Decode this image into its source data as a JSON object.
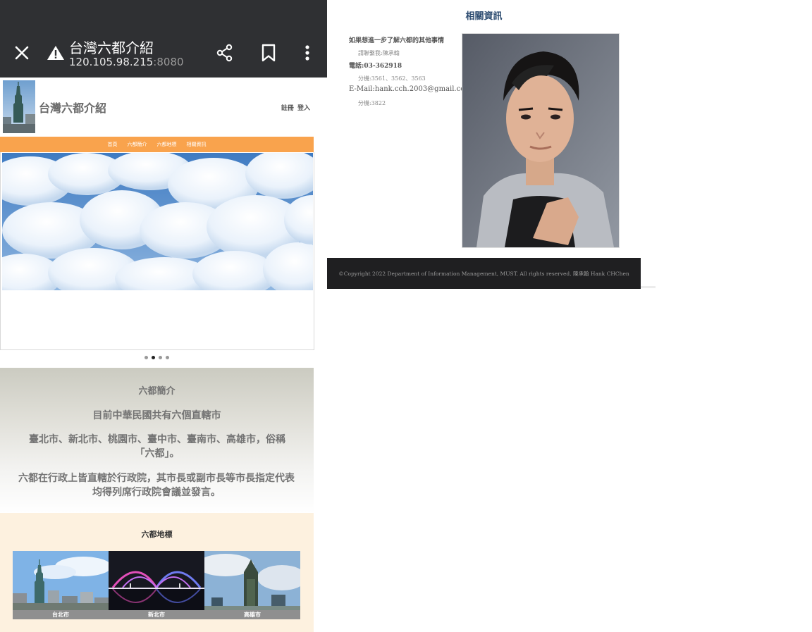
{
  "browser": {
    "page_title": "台灣六都介紹",
    "url_host": "120.105.98.215",
    "url_port": ":8080"
  },
  "site": {
    "title": "台灣六都介紹",
    "register": "註冊",
    "login": "登入",
    "nav": [
      "首頁",
      "六都簡介",
      "六都地標",
      "相關資訊"
    ]
  },
  "intro": {
    "heading": "六都簡介",
    "line1": "目前中華民國共有六個直轄市",
    "line2": "臺北市、新北市、桃園市、臺中市、臺南市、高雄市，俗稱「六都」。",
    "line3": "六都在行政上皆直轄於行政院，其市長或副市長等市長指定代表均得列席行政院會議並發言。"
  },
  "landmarks": {
    "heading": "六都地標",
    "items": [
      "台北市",
      "新北市",
      "高雄市"
    ]
  },
  "info": {
    "heading": "相關資訊",
    "question": "如果想進一步了解六都的其他事情",
    "contact": "請聯繫我:陳承翰",
    "phone": "電話:03-362918",
    "ext1": "分機:3561、3562、3563",
    "email": "E-Mail:hank.cch.2003@gmail.com",
    "ext2": "分機:3822"
  },
  "footer": {
    "copyright": "©Copyright 2022 Department of Information Management, MUST. All rights reserved. 陳承翰 Hank CHChen"
  },
  "carousel": {
    "slide_count": 4,
    "active_index": 1
  },
  "colors": {
    "nav": "#f9a34d",
    "chrome": "#2f3033",
    "footer": "#1f1f21",
    "landmarks_bg": "#fdf1df",
    "heading_blue": "#2b4a6f"
  }
}
